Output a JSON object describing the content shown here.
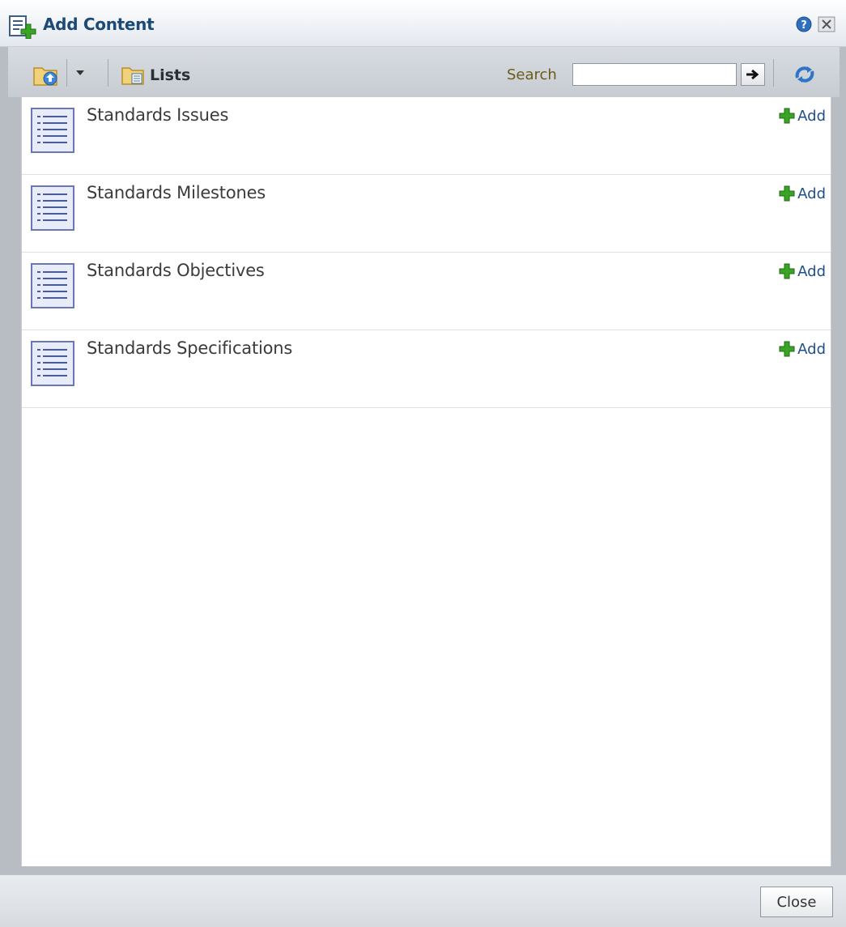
{
  "dialog": {
    "title": "Add Content",
    "icons": {
      "title": "add-content-icon",
      "help": "help-icon",
      "close": "close-icon"
    }
  },
  "toolbar": {
    "up_folder_icon": "folder-up-icon",
    "dropdown_icon": "chevron-down-icon",
    "location_icon": "lists-folder-icon",
    "location_label": "Lists",
    "search_label": "Search",
    "search_value": "",
    "go_icon": "arrow-right-icon",
    "refresh_icon": "refresh-icon"
  },
  "items": [
    {
      "title": "Standards Issues",
      "add_label": "Add",
      "icon": "list-icon"
    },
    {
      "title": "Standards Milestones",
      "add_label": "Add",
      "icon": "list-icon"
    },
    {
      "title": "Standards Objectives",
      "add_label": "Add",
      "icon": "list-icon"
    },
    {
      "title": "Standards Specifications",
      "add_label": "Add",
      "icon": "list-icon"
    }
  ],
  "footer": {
    "close_label": "Close"
  },
  "colors": {
    "title_text": "#1c4a75",
    "add_link": "#1f4f8b",
    "add_plus": "#3aa524",
    "frame": "#b8bcc3"
  }
}
